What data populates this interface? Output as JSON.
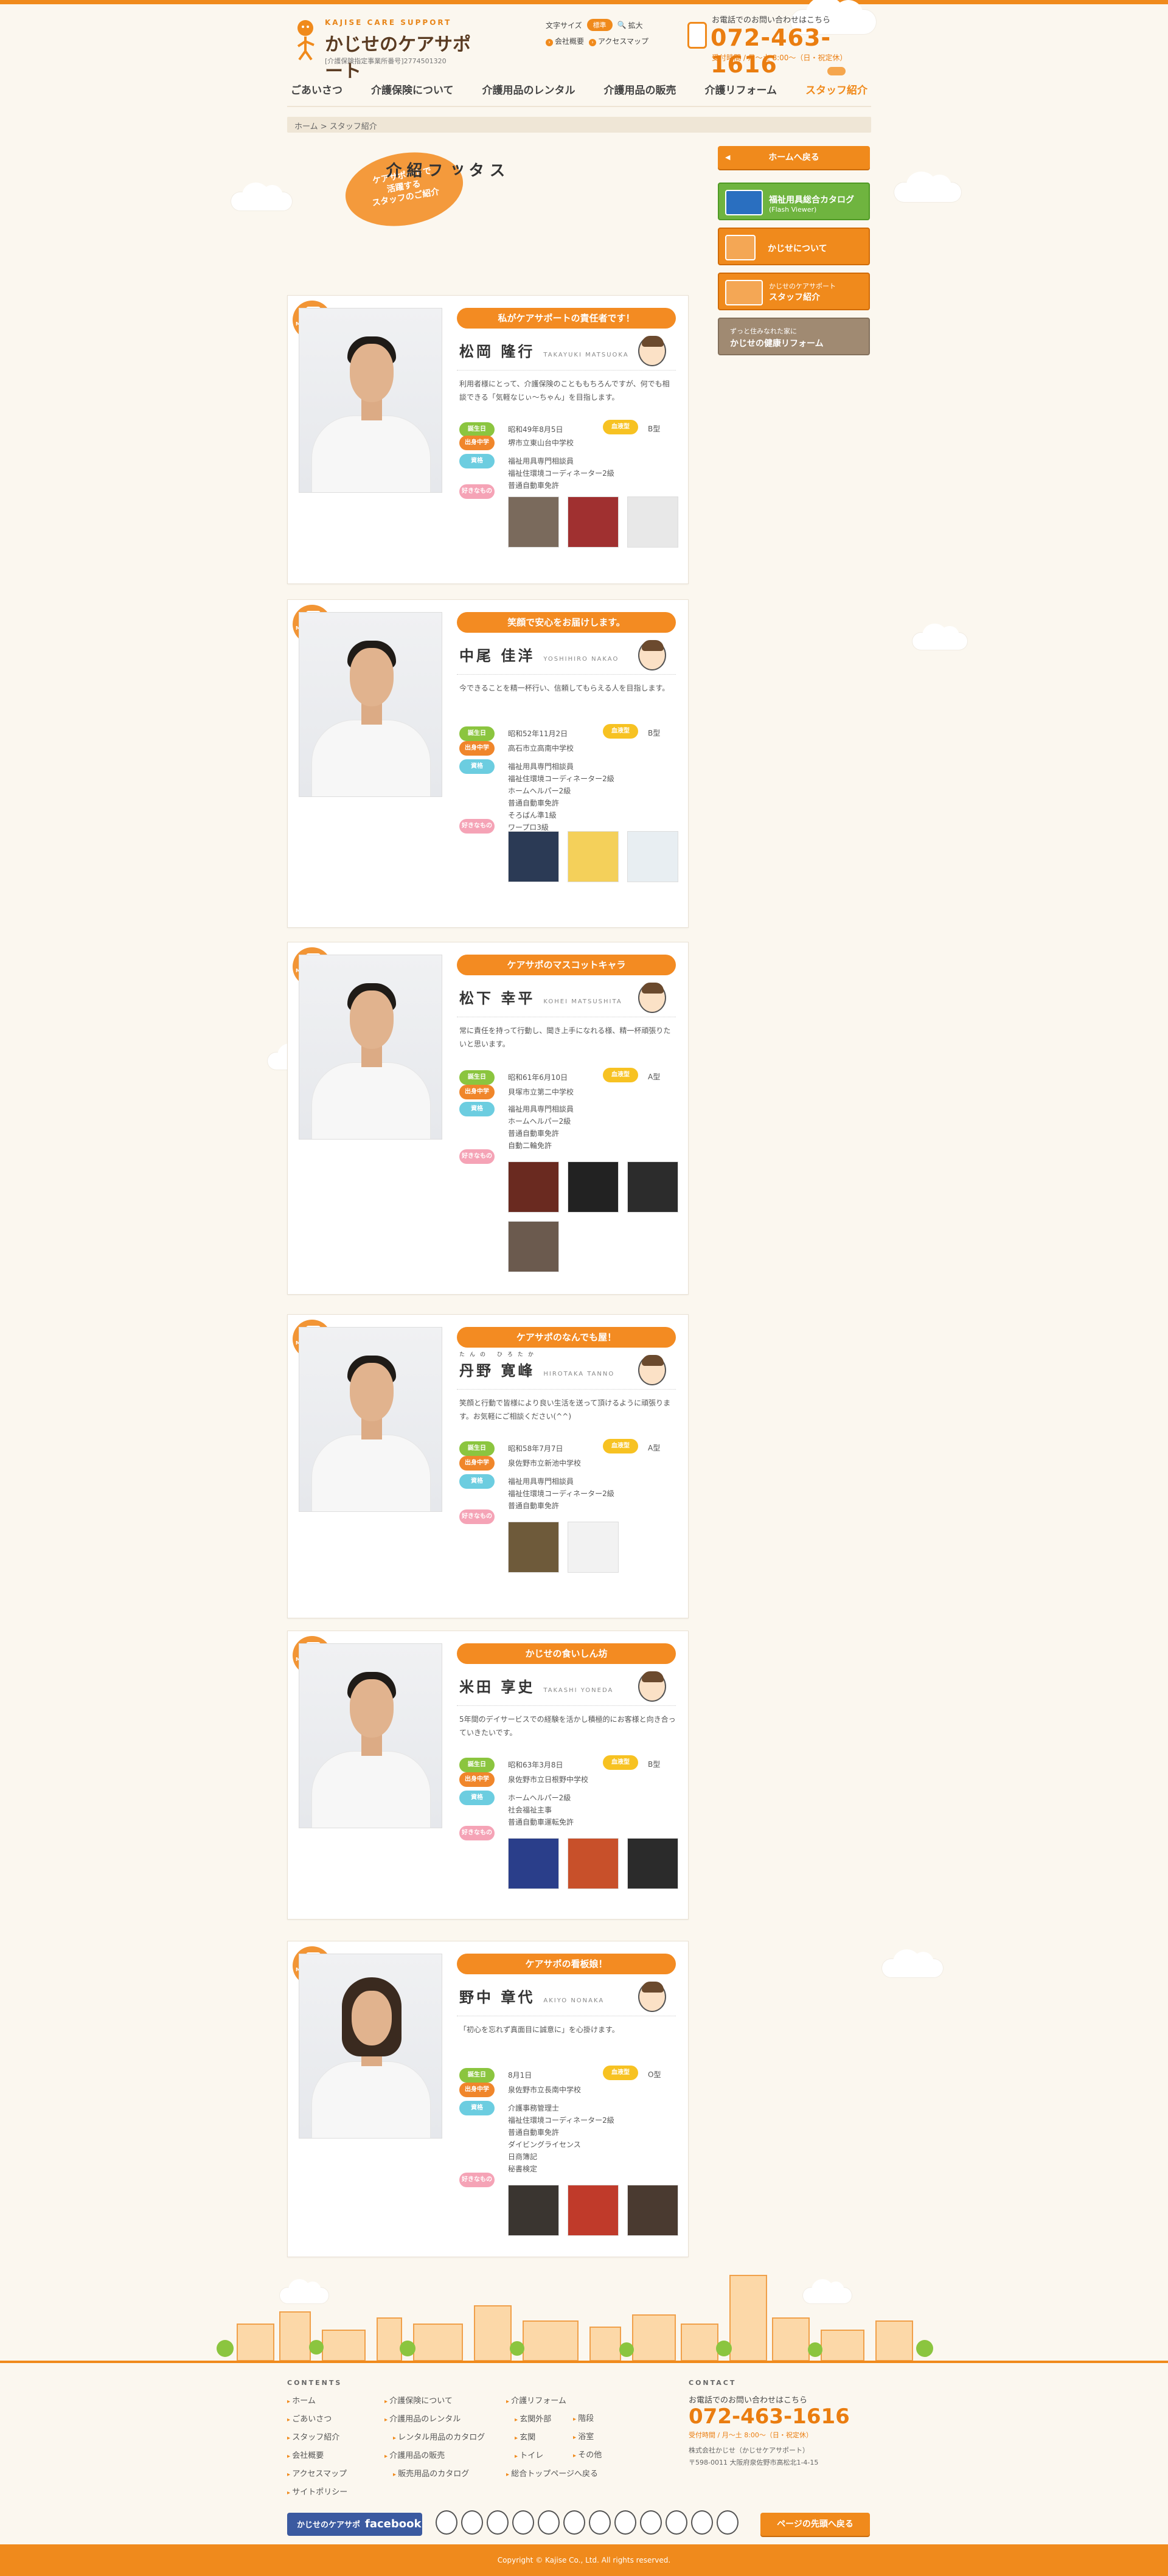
{
  "header": {
    "logo_sub": "KAJISE CARE SUPPORT",
    "logo_title": "かじせのケアサポート",
    "license": "[介護保険指定事業所番号]2774501320",
    "font_size_label": "文字サイズ",
    "font_size_standard": "標準",
    "font_size_large": "拡大",
    "company_link": "会社概要",
    "access_link": "アクセスマップ",
    "tel_caption": "お電話でのお問い合わせはこちら",
    "tel_number": "072-463-1616",
    "tel_hours": "受付時間 / 月〜土 8:00〜（日・祝定休）"
  },
  "nav": [
    "ごあいさつ",
    "介護保険について",
    "介護用品のレンタル",
    "介護用品の販売",
    "介護リフォーム",
    "スタッフ紹介"
  ],
  "breadcrumb": "ホーム > スタッフ紹介",
  "page": {
    "bubble": "ケアサポートで\n活躍する\nスタッフのご紹介",
    "title": "スタッフ紹介"
  },
  "labels": {
    "badge": "MORE SHOT",
    "birthday": "誕生日",
    "school": "出身中学",
    "license": "資格",
    "favorite": "好きなもの",
    "blood": "血液型"
  },
  "staff": [
    {
      "ribbon": "私がケアサポートの責任者です！",
      "name": "松岡 隆行",
      "name_en": "TAKAYUKI MATSUOKA",
      "intro": "利用者様にとって、介護保険のことももちろんですが、何でも相談できる「気軽なじぃ〜ちゃん」を目指します。",
      "birthday": "昭和49年8月5日",
      "blood": "B型",
      "school": "堺市立東山台中学校",
      "licenses": "福祉用具専門相談員\n福祉住環境コーディネーター2級\n普通自動車免許"
    },
    {
      "ribbon": "笑顔で安心をお届けします。",
      "name": "中尾 佳洋",
      "name_en": "YOSHIHIRO NAKAO",
      "intro": "今できることを精一杯行い、信頼してもらえる人を目指します。",
      "birthday": "昭和52年11月2日",
      "blood": "B型",
      "school": "高石市立高南中学校",
      "licenses": "福祉用具専門相談員\n福祉住環境コーディネーター2級\nホームヘルパー2級\n普通自動車免許\nそろばん準1級\nワープロ3級"
    },
    {
      "ribbon": "ケアサポのマスコットキャラ",
      "name": "松下 幸平",
      "name_en": "KOHEI MATSUSHITA",
      "intro": "常に責任を持って行動し、聞き上手になれる様、精一杯頑張りたいと思います。",
      "birthday": "昭和61年6月10日",
      "blood": "A型",
      "school": "貝塚市立第二中学校",
      "licenses": "福祉用具専門相談員\nホームヘルパー2級\n普通自動車免許\n自動二輪免許"
    },
    {
      "ribbon": "ケアサポのなんでも屋！",
      "name": "丹野 寛峰",
      "ruby": "たんの ひろたか",
      "name_en": "HIROTAKA TANNO",
      "intro": "笑顔と行動で皆様により良い生活を送って頂けるように頑張ります。お気軽にご相談ください(^^)",
      "birthday": "昭和58年7月7日",
      "blood": "A型",
      "school": "泉佐野市立新池中学校",
      "licenses": "福祉用具専門相談員\n福祉住環境コーディネーター2級\n普通自動車免許"
    },
    {
      "ribbon": "かじせの食いしん坊",
      "name": "米田 享史",
      "name_en": "TAKASHI YONEDA",
      "intro": "5年間のデイサービスでの経験を活かし積極的にお客様と向き合っていきたいです。",
      "birthday": "昭和63年3月8日",
      "blood": "B型",
      "school": "泉佐野市立日根野中学校",
      "licenses": "ホームヘルパー2級\n社会福祉主事\n普通自動車運転免許"
    },
    {
      "ribbon": "ケアサポの看板娘！",
      "name": "野中 章代",
      "name_en": "AKIYO NONAKA",
      "intro": "「初心を忘れず真面目に誠意に」を心掛けます。",
      "birthday": "8月1日",
      "blood": "O型",
      "school": "泉佐野市立長南中学校",
      "licenses": "介護事務管理士\n福祉住環境コーディネーター2級\n普通自動車免許\nダイビングライセンス\n日商簿記\n秘書検定"
    }
  ],
  "sidebar": {
    "back": "ホームへ戻る",
    "catalog_title": "福祉用具総合カタログ",
    "catalog_sub": "(Flash Viewer)",
    "about": "かじせについて",
    "staff_small": "かじせのケアサポート",
    "staff": "スタッフ紹介",
    "reform_small": "ずっと住みなれた家に",
    "reform": "かじせの健康リフォーム"
  },
  "footer": {
    "contents_head": "CONTENTS",
    "contact_head": "CONTACT",
    "col1": [
      "ホーム",
      "ごあいさつ",
      "スタッフ紹介",
      "会社概要",
      "アクセスマップ",
      "サイトポリシー"
    ],
    "col2": [
      "介護保険について",
      "介護用品のレンタル",
      "レンタル用品のカタログ",
      "介護用品の販売",
      "販売用品のカタログ"
    ],
    "col3": [
      "介護リフォーム",
      "玄関外部",
      "玄関",
      "トイレ"
    ],
    "col3b": [
      "階段",
      "浴室",
      "その他"
    ],
    "col3c": "総合トップページへ戻る",
    "tel_caption": "お電話でのお問い合わせはこちら",
    "tel_number": "072-463-1616",
    "tel_hours": "受付時間 / 月〜土 8:00〜（日・祝定休）",
    "company": "株式会社かじせ（かじせケアサポート）",
    "address": "〒598-0011 大阪府泉佐野市高松北1-4-15",
    "facebook_label": "かじせのケアサポ",
    "facebook_word": "facebook",
    "top_button": "ページの先頭へ戻る",
    "copyright": "Copyright © Kajise Co., Ltd. All rights reserved."
  }
}
